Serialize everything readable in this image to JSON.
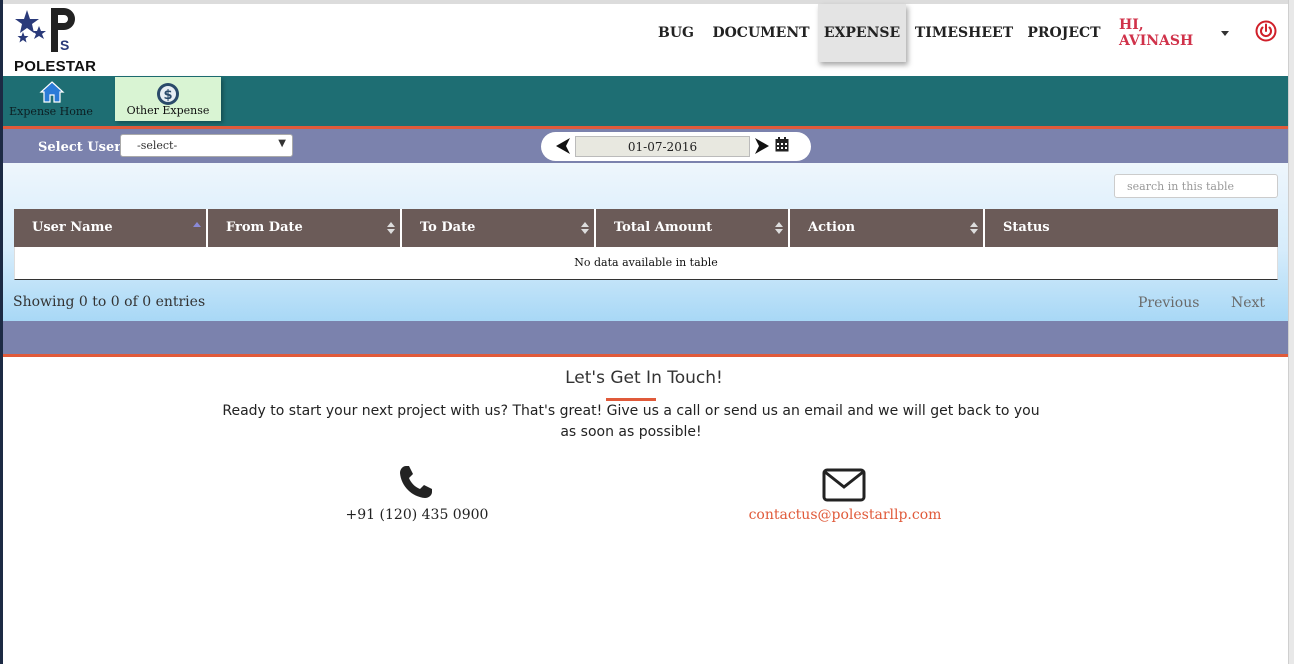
{
  "brand": {
    "name": "POLESTAR",
    "logo_letters": "PS"
  },
  "nav": {
    "items": [
      {
        "label": "BUG"
      },
      {
        "label": "DOCUMENT"
      },
      {
        "label": "EXPENSE"
      },
      {
        "label": "TIMESHEET"
      },
      {
        "label": "PROJECT"
      }
    ],
    "active": "EXPENSE",
    "user_greeting": "HI, AVINASH",
    "icons": {
      "power": "power-icon",
      "caret": "caret-down-icon"
    },
    "colors": {
      "user": "#d0324a",
      "power": "#d0202a"
    }
  },
  "submenu": {
    "items": [
      {
        "label": "Expense Home",
        "icon": "home-icon"
      },
      {
        "label": "Other Expense",
        "icon": "dollar-coin-icon"
      }
    ],
    "colors": {
      "bar": "#1e6e73",
      "accent_line": "#e05a3a",
      "active_item": "#d9f4d3"
    }
  },
  "filters": {
    "select_user_label": "Select User :",
    "select_user_value": "-select-",
    "date_value": "01-07-2016",
    "icons": {
      "prev": "arrow-left-icon",
      "next": "arrow-right-icon",
      "calendar": "calendar-icon"
    }
  },
  "table": {
    "search_placeholder": "search in this table",
    "columns": [
      "User Name",
      "From Date",
      "To Date",
      "Total Amount",
      "Action",
      "Status"
    ],
    "empty_message": "No data available in table",
    "showing": "Showing 0 to 0 of 0 entries",
    "pager": {
      "previous": "Previous",
      "next": "Next"
    },
    "colors": {
      "header": "#6b5b58"
    }
  },
  "contact": {
    "title": "Let's Get In Touch!",
    "text": "Ready to start your next project with us? That's great! Give us a call or send us an email and we will get back to you as soon as possible!",
    "phone": "+91 (120) 435 0900",
    "email": "contactus@polestarllp.com",
    "icons": {
      "phone": "phone-icon",
      "mail": "envelope-icon"
    },
    "colors": {
      "email": "#e05a3a"
    }
  }
}
